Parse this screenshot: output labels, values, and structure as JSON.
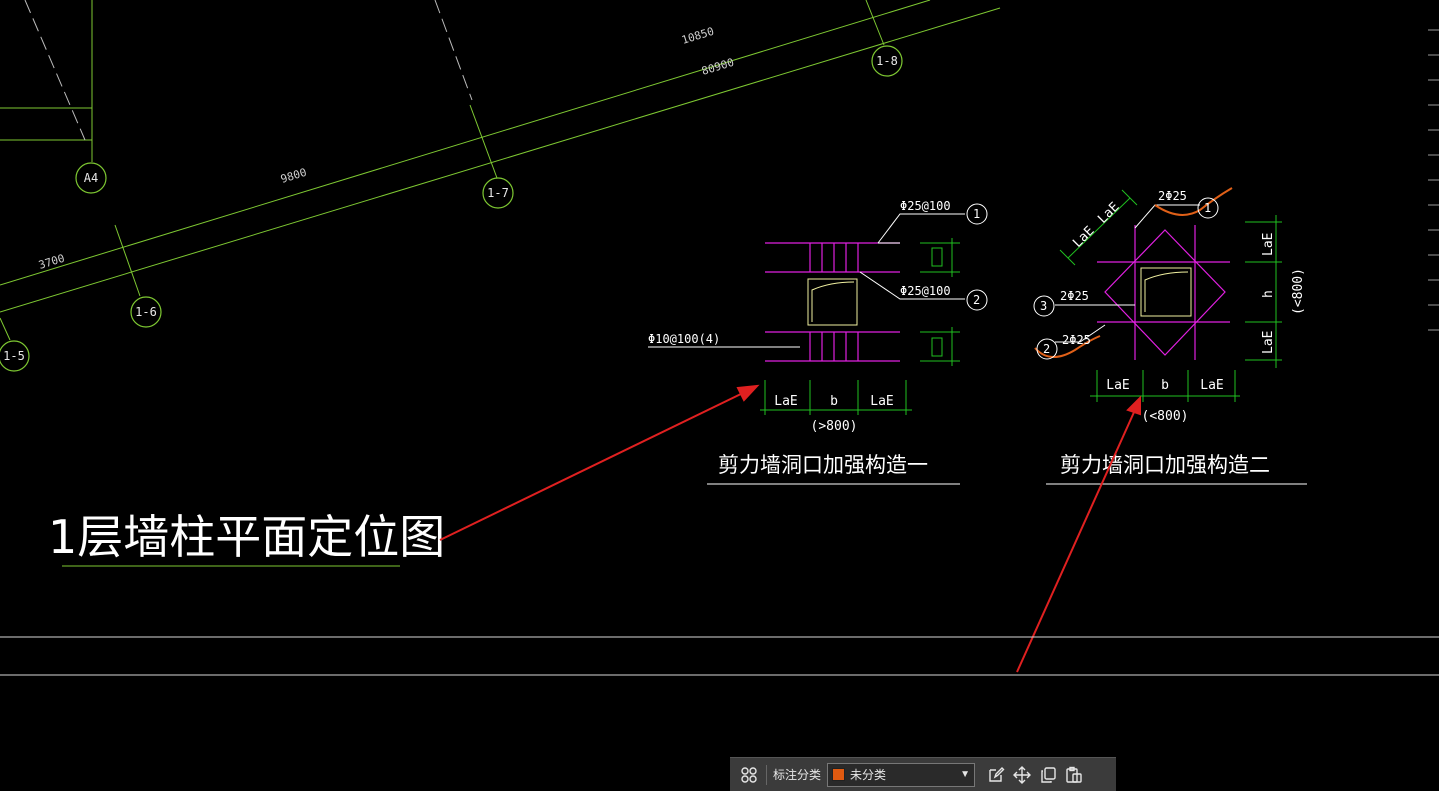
{
  "drawing": {
    "layout_title": "1层墙柱平面定位图",
    "axis_dims": [
      "10850",
      "80900",
      "9800",
      "3700"
    ],
    "axis_bubbles": [
      "1-8",
      "A4",
      "1-7",
      "1-6",
      "1-5"
    ],
    "detail1": {
      "title": "剪力墙洞口加强构造一",
      "rebar_top": "Φ25@100",
      "rebar_mid": "Φ25@100",
      "stirrup": "Φ10@100(4)",
      "bubble_top": "1",
      "bubble_mid": "2",
      "dim_left": "LaE",
      "dim_mid": "b",
      "dim_right": "LaE",
      "dim_note": "(>800)"
    },
    "detail2": {
      "title": "剪力墙洞口加强构造二",
      "rebar_top": "2Φ25",
      "rebar_left": "2Φ25",
      "rebar_bottom": "2Φ25",
      "bubble_top": "1",
      "bubble_left": "3",
      "bubble_bottom": "2",
      "diag_dim_1": "LaE",
      "diag_dim_2": "LaE",
      "dim_left": "LaE",
      "dim_mid": "b",
      "dim_right": "LaE",
      "dim_note": "(<800)",
      "vdim_top": "LaE",
      "vdim_mid": "h",
      "vdim_bottom": "LaE",
      "vdim_note": "(<800)"
    }
  },
  "toolbar": {
    "label": "标注分类",
    "selected": "未分类",
    "swatch_color": "#e05a10"
  },
  "colors": {
    "axis": "#7ec832",
    "magenta": "#e020e0",
    "green": "#20c020",
    "arrow": "#e02020",
    "orange": "#e06018"
  }
}
